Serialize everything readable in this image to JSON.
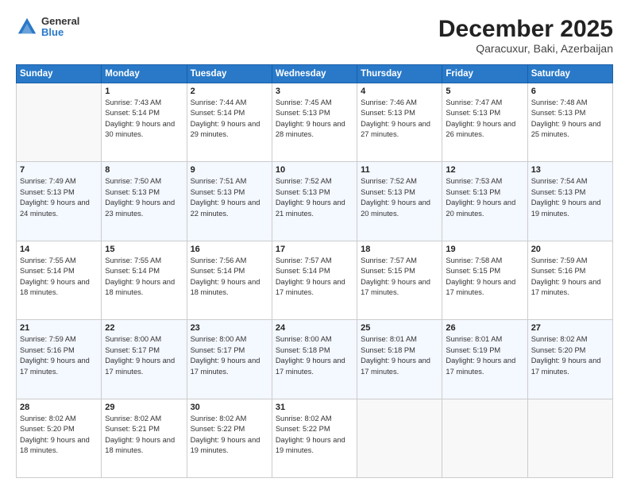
{
  "header": {
    "logo": {
      "general": "General",
      "blue": "Blue"
    },
    "title": "December 2025",
    "location": "Qaracuxur, Baki, Azerbaijan"
  },
  "calendar": {
    "days_of_week": [
      "Sunday",
      "Monday",
      "Tuesday",
      "Wednesday",
      "Thursday",
      "Friday",
      "Saturday"
    ],
    "weeks": [
      [
        {
          "day": "",
          "empty": true
        },
        {
          "day": "1",
          "sunrise": "7:43 AM",
          "sunset": "5:14 PM",
          "daylight": "9 hours and 30 minutes."
        },
        {
          "day": "2",
          "sunrise": "7:44 AM",
          "sunset": "5:14 PM",
          "daylight": "9 hours and 29 minutes."
        },
        {
          "day": "3",
          "sunrise": "7:45 AM",
          "sunset": "5:13 PM",
          "daylight": "9 hours and 28 minutes."
        },
        {
          "day": "4",
          "sunrise": "7:46 AM",
          "sunset": "5:13 PM",
          "daylight": "9 hours and 27 minutes."
        },
        {
          "day": "5",
          "sunrise": "7:47 AM",
          "sunset": "5:13 PM",
          "daylight": "9 hours and 26 minutes."
        },
        {
          "day": "6",
          "sunrise": "7:48 AM",
          "sunset": "5:13 PM",
          "daylight": "9 hours and 25 minutes."
        }
      ],
      [
        {
          "day": "7",
          "sunrise": "7:49 AM",
          "sunset": "5:13 PM",
          "daylight": "9 hours and 24 minutes."
        },
        {
          "day": "8",
          "sunrise": "7:50 AM",
          "sunset": "5:13 PM",
          "daylight": "9 hours and 23 minutes."
        },
        {
          "day": "9",
          "sunrise": "7:51 AM",
          "sunset": "5:13 PM",
          "daylight": "9 hours and 22 minutes."
        },
        {
          "day": "10",
          "sunrise": "7:52 AM",
          "sunset": "5:13 PM",
          "daylight": "9 hours and 21 minutes."
        },
        {
          "day": "11",
          "sunrise": "7:52 AM",
          "sunset": "5:13 PM",
          "daylight": "9 hours and 20 minutes."
        },
        {
          "day": "12",
          "sunrise": "7:53 AM",
          "sunset": "5:13 PM",
          "daylight": "9 hours and 20 minutes."
        },
        {
          "day": "13",
          "sunrise": "7:54 AM",
          "sunset": "5:13 PM",
          "daylight": "9 hours and 19 minutes."
        }
      ],
      [
        {
          "day": "14",
          "sunrise": "7:55 AM",
          "sunset": "5:14 PM",
          "daylight": "9 hours and 18 minutes."
        },
        {
          "day": "15",
          "sunrise": "7:55 AM",
          "sunset": "5:14 PM",
          "daylight": "9 hours and 18 minutes."
        },
        {
          "day": "16",
          "sunrise": "7:56 AM",
          "sunset": "5:14 PM",
          "daylight": "9 hours and 18 minutes."
        },
        {
          "day": "17",
          "sunrise": "7:57 AM",
          "sunset": "5:14 PM",
          "daylight": "9 hours and 17 minutes."
        },
        {
          "day": "18",
          "sunrise": "7:57 AM",
          "sunset": "5:15 PM",
          "daylight": "9 hours and 17 minutes."
        },
        {
          "day": "19",
          "sunrise": "7:58 AM",
          "sunset": "5:15 PM",
          "daylight": "9 hours and 17 minutes."
        },
        {
          "day": "20",
          "sunrise": "7:59 AM",
          "sunset": "5:16 PM",
          "daylight": "9 hours and 17 minutes."
        }
      ],
      [
        {
          "day": "21",
          "sunrise": "7:59 AM",
          "sunset": "5:16 PM",
          "daylight": "9 hours and 17 minutes."
        },
        {
          "day": "22",
          "sunrise": "8:00 AM",
          "sunset": "5:17 PM",
          "daylight": "9 hours and 17 minutes."
        },
        {
          "day": "23",
          "sunrise": "8:00 AM",
          "sunset": "5:17 PM",
          "daylight": "9 hours and 17 minutes."
        },
        {
          "day": "24",
          "sunrise": "8:00 AM",
          "sunset": "5:18 PM",
          "daylight": "9 hours and 17 minutes."
        },
        {
          "day": "25",
          "sunrise": "8:01 AM",
          "sunset": "5:18 PM",
          "daylight": "9 hours and 17 minutes."
        },
        {
          "day": "26",
          "sunrise": "8:01 AM",
          "sunset": "5:19 PM",
          "daylight": "9 hours and 17 minutes."
        },
        {
          "day": "27",
          "sunrise": "8:02 AM",
          "sunset": "5:20 PM",
          "daylight": "9 hours and 17 minutes."
        }
      ],
      [
        {
          "day": "28",
          "sunrise": "8:02 AM",
          "sunset": "5:20 PM",
          "daylight": "9 hours and 18 minutes."
        },
        {
          "day": "29",
          "sunrise": "8:02 AM",
          "sunset": "5:21 PM",
          "daylight": "9 hours and 18 minutes."
        },
        {
          "day": "30",
          "sunrise": "8:02 AM",
          "sunset": "5:22 PM",
          "daylight": "9 hours and 19 minutes."
        },
        {
          "day": "31",
          "sunrise": "8:02 AM",
          "sunset": "5:22 PM",
          "daylight": "9 hours and 19 minutes."
        },
        {
          "day": "",
          "empty": true
        },
        {
          "day": "",
          "empty": true
        },
        {
          "day": "",
          "empty": true
        }
      ]
    ]
  }
}
